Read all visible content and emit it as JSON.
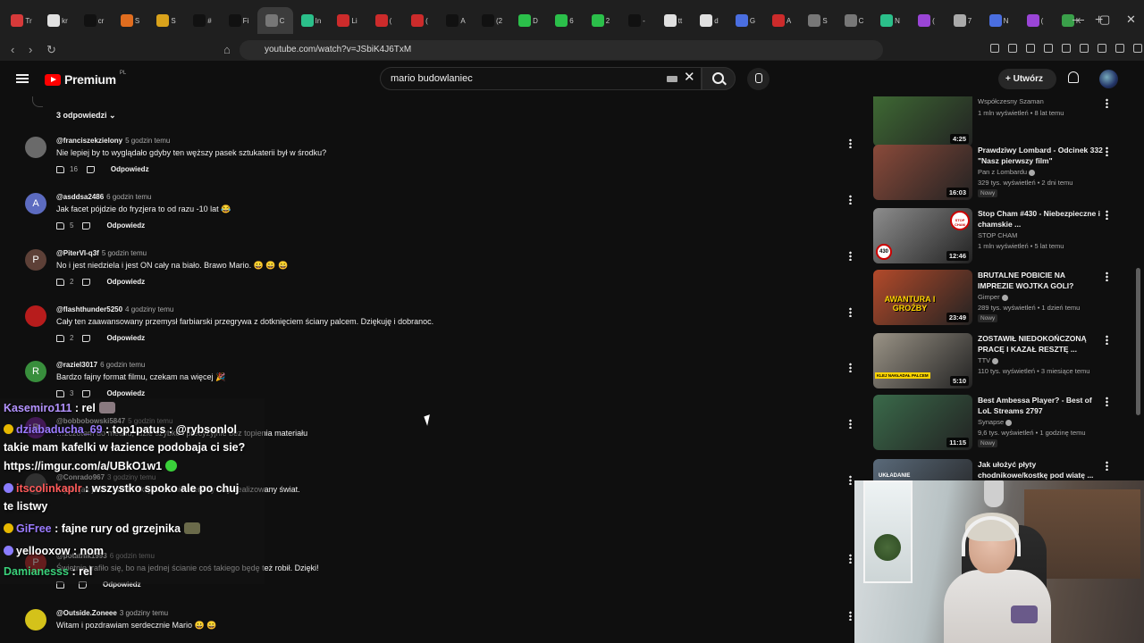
{
  "browser": {
    "tabs": [
      {
        "label": "Tr",
        "color": "#d63a3a"
      },
      {
        "label": "kr",
        "color": "#e0e0e0"
      },
      {
        "label": "cr",
        "color": "#111111"
      },
      {
        "label": "S",
        "color": "#e06d1f"
      },
      {
        "label": "S",
        "color": "#d9a21b"
      },
      {
        "label": "#",
        "color": "#111111"
      },
      {
        "label": "Fi",
        "color": "#111111"
      },
      {
        "label": "C",
        "color": "#777777",
        "active": true
      },
      {
        "label": "In",
        "color": "#2bbf8a"
      },
      {
        "label": "Li",
        "color": "#cc2b2b"
      },
      {
        "label": "(",
        "color": "#cc2b2b"
      },
      {
        "label": "(",
        "color": "#cc2b2b"
      },
      {
        "label": "A",
        "color": "#111111"
      },
      {
        "label": "(2",
        "color": "#111111"
      },
      {
        "label": "D",
        "color": "#2bbf4a"
      },
      {
        "label": "6",
        "color": "#2bbf4a"
      },
      {
        "label": "2",
        "color": "#2bbf4a"
      },
      {
        "label": "-",
        "color": "#111111"
      },
      {
        "label": "tt",
        "color": "#e0e0e0"
      },
      {
        "label": "d",
        "color": "#e0e0e0"
      },
      {
        "label": "G",
        "color": "#4a6ee0"
      },
      {
        "label": "A",
        "color": "#cc2b2b"
      },
      {
        "label": "S",
        "color": "#777777"
      },
      {
        "label": "C",
        "color": "#777777"
      },
      {
        "label": "N",
        "color": "#2bbf8a"
      },
      {
        "label": "(",
        "color": "#9a45d6"
      },
      {
        "label": "7",
        "color": "#aaaaaa"
      },
      {
        "label": "N",
        "color": "#4a6ee0"
      },
      {
        "label": "(",
        "color": "#9a45d6"
      },
      {
        "label": "K",
        "color": "#3aa04a"
      }
    ],
    "new_tab": "+",
    "url": "youtube.com/watch?v=JSbiK4J6TxM"
  },
  "header": {
    "logo_text": "Premium",
    "country_code": "PL",
    "search_value": "mario budowlaniec",
    "create_label": "Utwórz"
  },
  "replies_toggle": "3 odpowiedzi",
  "comments": [
    {
      "author": "@franciszekzielony",
      "time": "5 godzin temu",
      "text": "Nie lepiej by to wyglądało gdyby ten węższy pasek sztukaterii był w środku?",
      "likes": "16",
      "reply": "Odpowiedz",
      "avatar_color": "#6a6a6a",
      "avatar_letter": ""
    },
    {
      "author": "@asddsa2486",
      "time": "6 godzin temu",
      "text": "Jak facet pójdzie do fryzjera to od razu -10 lat 😂",
      "likes": "5",
      "reply": "Odpowiedz",
      "avatar_color": "#5c6bc0",
      "avatar_letter": "A"
    },
    {
      "author": "@PiterVI-q3f",
      "time": "5 godzin temu",
      "text": "No i jest niedziela i jest ON cały na biało. Brawo Mario. 😀 😀 😀",
      "likes": "2",
      "reply": "Odpowiedz",
      "avatar_color": "#5d4037",
      "avatar_letter": "P"
    },
    {
      "author": "@flashthunder5250",
      "time": "4 godziny temu",
      "text": "Cały ten zaawansowany przemysł farbiarski przegrywa z dotknięciem ściany palcem. Dziękuję i dobranoc.",
      "likes": "2",
      "reply": "Odpowiedz",
      "avatar_color": "#b71c1c",
      "avatar_letter": ""
    },
    {
      "author": "@raziel3017",
      "time": "6 godzin temu",
      "text": "Bardzo fajny format filmu, czekam na więcej 🎉",
      "likes": "3",
      "reply": "Odpowiedz",
      "avatar_color": "#388e3c",
      "avatar_letter": "R"
    },
    {
      "author": "@bobbobowski5847",
      "time": "5 godzin temu",
      "text": "…zczotem do metalu, idzie szybko i precyzyjnie bez topienia materiału",
      "likes": "",
      "reply": "",
      "avatar_color": "#7b1fa2",
      "avatar_letter": "B"
    },
    {
      "author": "@Conrado967",
      "time": "3 godziny temu",
      "text": "…jest jak jest z takimi akcjami, a nie sterylny i wyidealizowany świat.",
      "likes": "",
      "reply": "",
      "avatar_color": "#555555",
      "avatar_letter": ""
    },
    {
      "author": "@potatnik1993",
      "time": "6 godzin temu",
      "text": "Świetnie trafiło się, bo na jednej ścianie coś takiego będę też robił. Dzięki!",
      "likes": "",
      "reply": "Odpowiedz",
      "avatar_color": "#c62828",
      "avatar_letter": "P"
    },
    {
      "author": "@Outside.Zoneee",
      "time": "3 godziny temu",
      "text": "Witam i pozdrawiam serdecznie Mario 😀 😀",
      "likes": "",
      "reply": "",
      "avatar_color": "#d4c21a",
      "avatar_letter": ""
    }
  ],
  "sidebar": [
    {
      "title": "Współczesny Szaman",
      "channel": "",
      "meta": "1 mln wyświetleń • 8 lat temu",
      "duration": "4:25",
      "new": "",
      "thumb": "#3f6b34"
    },
    {
      "title": "Prawdziwy Lombard - Odcinek 332 \"Nasz pierwszy film\"",
      "channel": "Pan z Lombardu",
      "meta": "329 tys. wyświetleń • 2 dni temu",
      "duration": "16:03",
      "new": "Nowy",
      "thumb": "#8a4a3a"
    },
    {
      "title": "Stop Cham #430 - Niebezpieczne i chamskie ...",
      "channel": "STOP CHAM",
      "meta": "1 mln wyświetleń • 5 lat temu",
      "duration": "12:46",
      "new": "",
      "thumb": "#8d8d8d"
    },
    {
      "title": "BRUTALNE POBICIE NA IMPREZIE WOJTKA GOLI?",
      "channel": "Gimper",
      "meta": "289 tys. wyświetleń • 1 dzień temu",
      "duration": "23:49",
      "new": "Nowy",
      "thumb": "#b34a2a"
    },
    {
      "title": "ZOSTAWIŁ NIEDOKOŃCZONĄ PRACĘ I KAZAŁ RESZTĘ ...",
      "channel": "TTV",
      "meta": "110 tys. wyświetleń • 3 miesiące temu",
      "duration": "5:10",
      "new": "",
      "thumb": "#9a9386"
    },
    {
      "title": "Best Ambessa Player? - Best of LoL Streams 2797",
      "channel": "Synapse",
      "meta": "9,6 tys. wyświetleń • 1 godzinę temu",
      "duration": "11:15",
      "new": "Nowy",
      "thumb": "#3a6a4a"
    },
    {
      "title": "Jak ułożyć płyty chodnikowe/kostkę pod wiatę ...",
      "channel": "",
      "meta": "",
      "duration": "",
      "new": "",
      "thumb": "#5a6a7a"
    }
  ],
  "thumb_labels": {
    "stop_cham": "STOP CHAM",
    "num_430": "430",
    "awantura": "AWANTURA I GROŹBY",
    "klej": "KLEJ NAKŁADAŁ PALCEM",
    "ukladanie": "UKŁADANIE"
  },
  "chat": [
    {
      "user": "Kasemiro111",
      "user_color": "#b493ff",
      "text": " : rel",
      "badge_color": ""
    },
    {
      "user": "dziabaducha_69",
      "user_color": "#9b7bff",
      "text": " : top1patus : @rybsonlol",
      "badge_color": "#e6b800"
    },
    {
      "user": "",
      "user_color": "#ffffff",
      "text": "takie mam kafelki w łazience podobaja ci sie?",
      "badge_color": ""
    },
    {
      "user": "",
      "user_color": "#ffffff",
      "text": "https://imgur.com/a/UBkO1w1",
      "badge_color": ""
    },
    {
      "user": "itscolinkaplr",
      "user_color": "#ff5a5a",
      "text": " : wszystko spoko ale po chuj",
      "badge_color": "#8a7cff"
    },
    {
      "user": "",
      "user_color": "#ffffff",
      "text": "te listwy",
      "badge_color": ""
    },
    {
      "user": "GiFree",
      "user_color": "#9b7bff",
      "text": " : fajne rury od grzejnika",
      "badge_color": "#e6b800"
    },
    {
      "user": "yellooxow",
      "user_color": "#ffffff",
      "text": " : nom",
      "badge_color": "#8a7cff"
    },
    {
      "user": "Damianesss",
      "user_color": "#3ad17a",
      "text": " : rel",
      "badge_color": ""
    }
  ]
}
